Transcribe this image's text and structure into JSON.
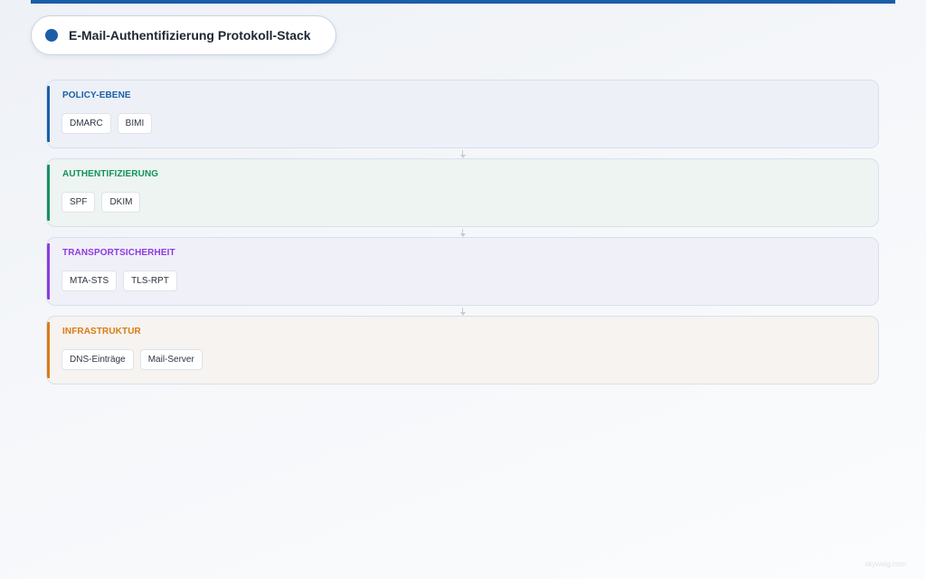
{
  "header": {
    "title": "E-Mail-Authentifizierung Protokoll-Stack",
    "accent_color": "#1b5ea8"
  },
  "layers": [
    {
      "title": "POLICY-EBENE",
      "color": "#1b5ea8",
      "background": "#edf1f7",
      "items": [
        "DMARC",
        "BIMI"
      ]
    },
    {
      "title": "AUTHENTIFIZIERUNG",
      "color": "#14925e",
      "background": "#edf4f2",
      "items": [
        "SPF",
        "DKIM"
      ]
    },
    {
      "title": "TRANSPORTSICHERHEIT",
      "color": "#8e3ae0",
      "background": "#f0f0f9",
      "items": [
        "MTA-STS",
        "TLS-RPT"
      ]
    },
    {
      "title": "INFRASTRUKTUR",
      "color": "#dc7b12",
      "background": "#f6f3f0",
      "items": [
        "DNS-Einträge",
        "Mail-Server"
      ]
    }
  ],
  "footer": {
    "watermark": "skywalg.com"
  }
}
